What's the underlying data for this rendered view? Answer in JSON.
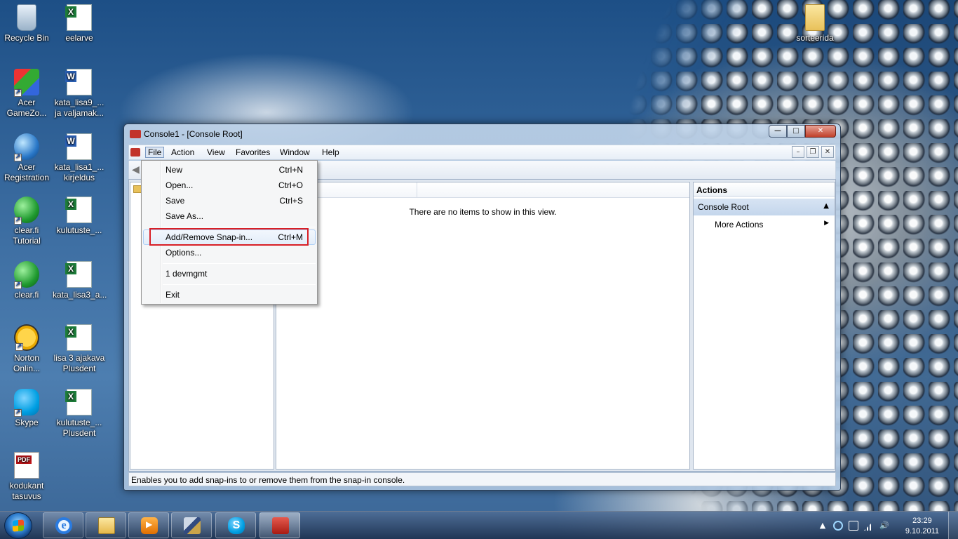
{
  "desktop": {
    "icons": [
      {
        "label": "Recycle Bin"
      },
      {
        "label": "eelarve"
      },
      {
        "label": "Acer GameZo..."
      },
      {
        "label": "kata_lisa9_... ja valjamak..."
      },
      {
        "label": "Acer Registration"
      },
      {
        "label": "kata_lisa1_... kirjeldus"
      },
      {
        "label": "clear.fi Tutorial"
      },
      {
        "label": "kulutuste_..."
      },
      {
        "label": "clear.fi"
      },
      {
        "label": "kata_lisa3_a..."
      },
      {
        "label": "Norton Onlin..."
      },
      {
        "label": "lisa 3 ajakava Plusdent"
      },
      {
        "label": "Skype"
      },
      {
        "label": "kulutuste_... Plusdent"
      },
      {
        "label": "kodukant tasuvus"
      },
      {
        "label": "sorteerida"
      }
    ]
  },
  "window": {
    "title": "Console1 - [Console Root]",
    "controls": {
      "minimize": "—",
      "maximize": "□",
      "close": "✕"
    },
    "menu": [
      "File",
      "Action",
      "View",
      "Favorites",
      "Window",
      "Help"
    ],
    "mdi_controls": {
      "minimize": "–",
      "restore": "❐",
      "close": "✕"
    },
    "list_empty_text": "There are no items to show in this view.",
    "actions": {
      "header": "Actions",
      "root": "Console Root",
      "more": "More Actions"
    },
    "status": "Enables you to add snap-ins to or remove them from the snap-in console."
  },
  "file_menu": {
    "items": [
      {
        "label": "New",
        "shortcut": "Ctrl+N"
      },
      {
        "label": "Open...",
        "shortcut": "Ctrl+O"
      },
      {
        "label": "Save",
        "shortcut": "Ctrl+S"
      },
      {
        "label": "Save As...",
        "shortcut": ""
      },
      {
        "label": "Add/Remove Snap-in...",
        "shortcut": "Ctrl+M"
      },
      {
        "label": "Options...",
        "shortcut": ""
      },
      {
        "label": "1 devmgmt",
        "shortcut": ""
      },
      {
        "label": "Exit",
        "shortcut": ""
      }
    ],
    "highlight_color": "#d81f26"
  },
  "taskbar": {
    "ie_glyph": "e",
    "skype_glyph": "S",
    "clock": {
      "time": "23:29",
      "date": "9.10.2011"
    },
    "tray_glyphs": {
      "arrow": "▲",
      "volume": "🔊"
    }
  }
}
